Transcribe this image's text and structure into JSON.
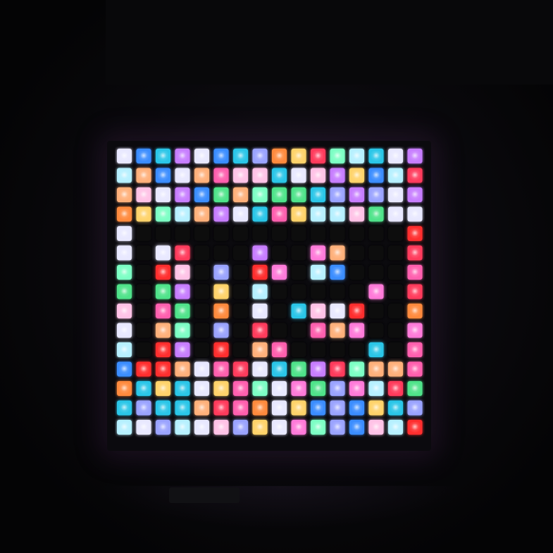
{
  "display": {
    "rows": 15,
    "cols": 16,
    "off_color": "#08070b",
    "palette": [
      "#ff5fae",
      "#29c6e8",
      "#ffb07a",
      "#c77dff",
      "#ff3b5c",
      "#4fe38a",
      "#ffd36b",
      "#e8e8ff",
      "#3a8dff",
      "#ff8a3d",
      "#b6f0ff",
      "#ff7ad9",
      "#7cffc4",
      "#ff2e2e",
      "#9aa3ff",
      "#ffc2e6"
    ],
    "pattern": [
      "1111111111111111",
      "1111111111111111",
      "1111111111111111",
      "1111111111111111",
      "1000000000000001",
      "1011000100110001",
      "1011010110110001",
      "1011010100000101",
      "1011010101111001",
      "1011010100111001",
      "1011010110000101",
      "1111111111111111",
      "1111111111111111",
      "1111111111111111",
      "1111111111111111"
    ]
  }
}
